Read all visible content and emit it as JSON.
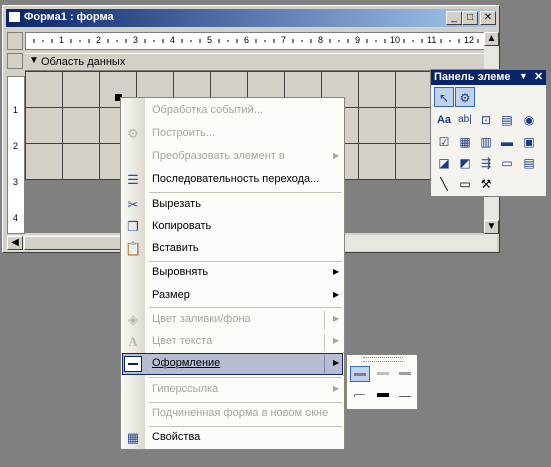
{
  "form_window": {
    "title": "Форма1 : форма",
    "minimize": "_",
    "maximize": "□",
    "close": "✕",
    "section_label": "Область данных",
    "ruler_numbers": [
      "1",
      "2",
      "3",
      "4",
      "5",
      "6",
      "7",
      "8",
      "9",
      "10",
      "11",
      "12"
    ],
    "vruler_numbers": [
      "1",
      "2",
      "3",
      "4"
    ]
  },
  "toolbox": {
    "title": "Панель элеме",
    "tools": [
      "pointer",
      "wizard",
      "label",
      "textbox",
      "option-group",
      "toggle",
      "option",
      "checkbox",
      "combobox",
      "listbox",
      "button",
      "image",
      "unbound-frame",
      "bound-frame",
      "page-break",
      "tab",
      "subform",
      "line",
      "rectangle",
      "more-controls"
    ],
    "label_glyph": "Aa",
    "textbox_glyph": "ab|"
  },
  "context_menu": {
    "items": [
      {
        "label": "Обработка событий...",
        "disabled": true,
        "icon": ""
      },
      {
        "label": "Построить...",
        "disabled": true,
        "icon": "build-icon"
      },
      {
        "label": "Преобразовать элемент в",
        "disabled": true,
        "submenu": true
      },
      {
        "label": "Последовательность перехода...",
        "disabled": false,
        "icon": "tab-order-icon"
      },
      {
        "label": "Вырезать",
        "disabled": false,
        "icon": "cut-icon"
      },
      {
        "label": "Копировать",
        "disabled": false,
        "icon": "copy-icon"
      },
      {
        "label": "Вставить",
        "disabled": false,
        "icon": "paste-icon"
      },
      {
        "label": "Выровнять",
        "disabled": false,
        "submenu": true
      },
      {
        "label": "Размер",
        "disabled": false,
        "submenu": true
      },
      {
        "label": "Цвет заливки/фона",
        "disabled": true,
        "submenu": true,
        "icon": "fill-color-icon"
      },
      {
        "label": "Цвет текста",
        "disabled": true,
        "submenu": true,
        "icon": "font-color-icon"
      },
      {
        "label": "Оформление",
        "disabled": false,
        "submenu": true,
        "icon": "special-effect-icon",
        "highlighted": true
      },
      {
        "label": "Гиперссылка",
        "disabled": true,
        "submenu": true
      },
      {
        "label": "Подчиненная форма в новом окне",
        "disabled": true
      },
      {
        "label": "Свойства",
        "disabled": false,
        "icon": "properties-icon"
      }
    ]
  },
  "colors": {
    "titlebar": "#0a246a",
    "menu_highlight": "#b6bdd2"
  }
}
